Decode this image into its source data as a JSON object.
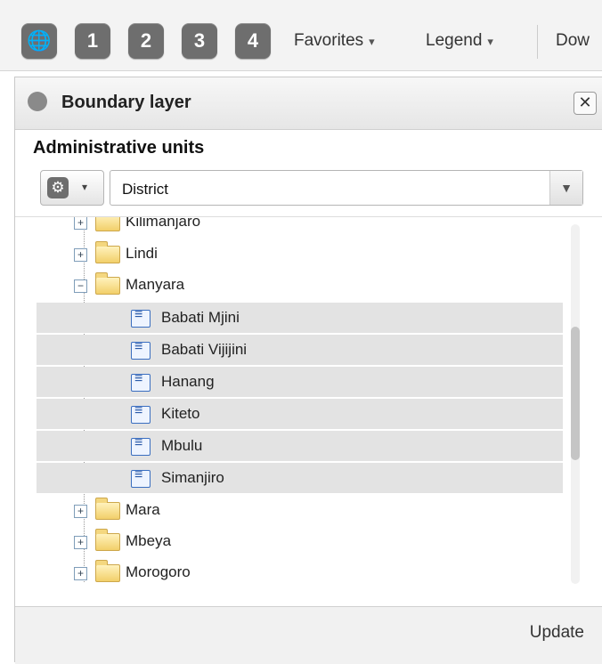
{
  "toolbar": {
    "buttons": [
      "1",
      "2",
      "3",
      "4"
    ],
    "favorites_label": "Favorites",
    "legend_label": "Legend",
    "download_label": "Dow",
    "globe_icon": "globe-icon"
  },
  "panel": {
    "title": "Boundary layer",
    "close_label": "✕",
    "section_title": "Administrative units",
    "select_value": "District",
    "update_label": "Update"
  },
  "tree": {
    "top_items": [
      "Kilimanjaro",
      "Lindi",
      "Manyara"
    ],
    "expanded": "Manyara",
    "children": [
      "Babati Mjini",
      "Babati Vijijini",
      "Hanang",
      "Kiteto",
      "Mbulu",
      "Simanjiro"
    ],
    "bottom_items": [
      "Mara",
      "Mbeya",
      "Morogoro"
    ]
  },
  "colors": {
    "button_grey": "#6e6e6e",
    "selection_bg": "#e3e3e3",
    "folder_yellow": "#f2cf6a",
    "leaf_blue": "#3a6ec0"
  }
}
